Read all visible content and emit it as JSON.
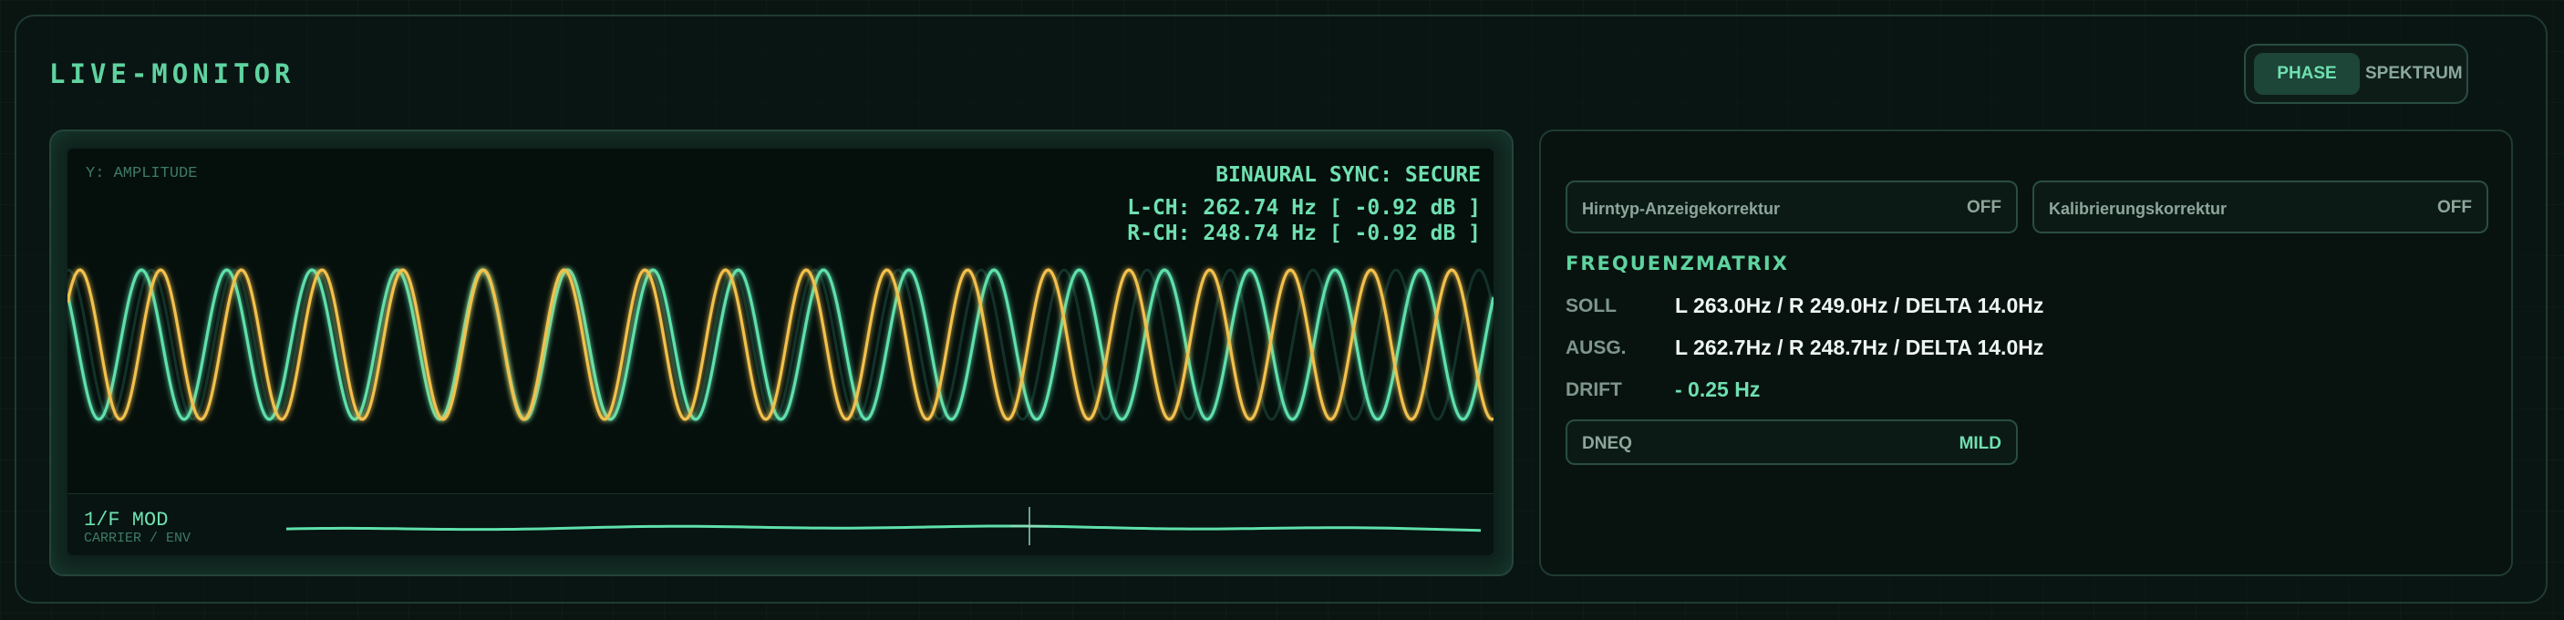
{
  "app": {
    "title": "LIVE-MONITOR"
  },
  "modes": {
    "items": [
      {
        "label": "PHASE",
        "active": true
      },
      {
        "label": "SPEKTRUM",
        "active": false
      }
    ]
  },
  "scope": {
    "y_axis_label": "Y: AMPLITUDE",
    "sync_status": "BINAURAL SYNC: SECURE",
    "left_channel": "L-CH: 262.74 Hz [ -0.92 dB ]",
    "right_channel": "R-CH: 248.74 Hz [ -0.92 dB ]",
    "colors": {
      "left": "#f2c14e",
      "right": "#5fe0ac"
    },
    "modulation": {
      "title": "1/F MOD",
      "subtitle": "CARRIER / ENV"
    }
  },
  "panel": {
    "toggles": [
      {
        "label": "Hirntyp-Anzeigekorrektur",
        "value": "OFF"
      },
      {
        "label": "Kalibrierungskorrektur",
        "value": "OFF"
      }
    ],
    "section_title": "FREQUENZMATRIX",
    "rows": [
      {
        "key": "SOLL",
        "value": "L 263.0Hz / R 249.0Hz / DELTA 14.0Hz"
      },
      {
        "key": "AUSG.",
        "value": "L 262.7Hz / R 248.7Hz / DELTA 14.0Hz"
      },
      {
        "key": "DRIFT",
        "value": "- 0.25 Hz"
      }
    ],
    "dneq": {
      "label": "DNEQ",
      "value": "MILD"
    }
  },
  "accent_color": "#5fd3a0"
}
